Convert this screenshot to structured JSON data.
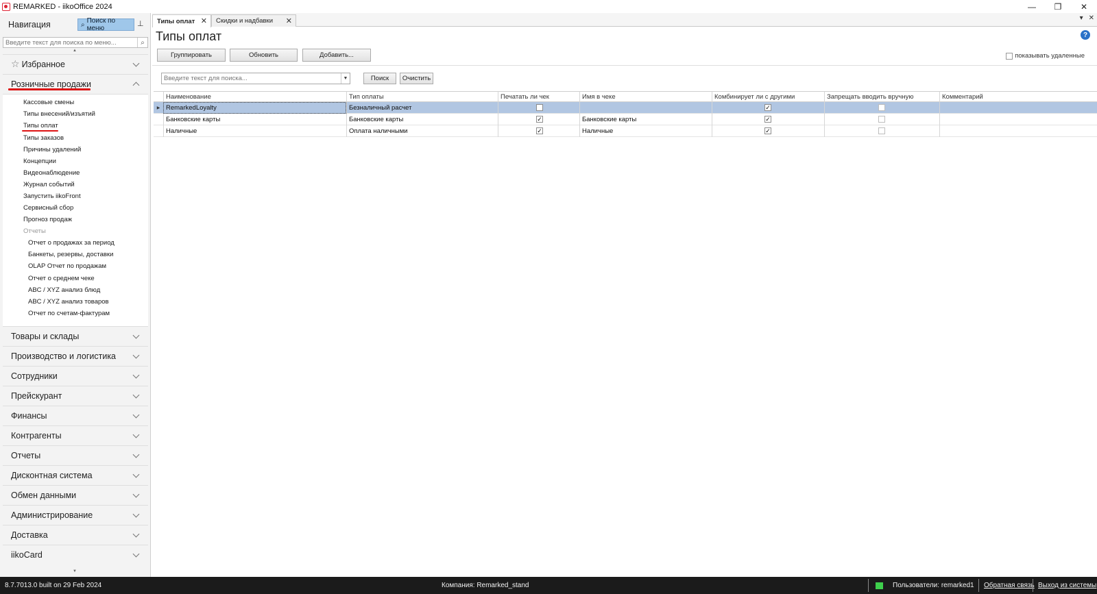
{
  "window": {
    "title": "REMARKED - iikoOffice 2024",
    "minimize": "—",
    "restore": "❐",
    "close": "✕"
  },
  "nav": {
    "title": "Навигация",
    "search_menu_btn": "Поиск по меню",
    "pin": "⊥",
    "search_placeholder": "Введите текст для поиска по меню...",
    "favorites": "Избранное",
    "retail": "Розничные продажи",
    "retail_items": [
      "Кассовые смены",
      "Типы внесений/изъятий",
      "Типы оплат",
      "Типы заказов",
      "Причины удалений",
      "Концепции",
      "Видеонаблюдение",
      "Журнал событий",
      "Запустить iikoFront",
      "Сервисный сбор",
      "Прогноз продаж"
    ],
    "reports_group": "Отчеты",
    "report_items": [
      "Отчет о продажах за период",
      "Банкеты, резервы, доставки",
      "OLAP Отчет по продажам",
      "Отчет о среднем чеке",
      "ABC / XYZ анализ блюд",
      "ABC / XYZ анализ товаров",
      "Отчет по счетам-фактурам"
    ],
    "sections": [
      "Товары и склады",
      "Производство и логистика",
      "Сотрудники",
      "Прейскурант",
      "Финансы",
      "Контрагенты",
      "Отчеты",
      "Дисконтная система",
      "Обмен данными",
      "Администрирование",
      "Доставка",
      "iikoCard"
    ]
  },
  "tabs": [
    {
      "label": "Типы оплат",
      "active": true
    },
    {
      "label": "Скидки и надбавки",
      "active": false
    }
  ],
  "page": {
    "title": "Типы оплат",
    "btn_group": "Группировать",
    "btn_refresh": "Обновить",
    "btn_add": "Добавить...",
    "show_deleted": "показывать удаленные",
    "search_placeholder": "Введите текст для поиска...",
    "btn_search": "Поиск",
    "btn_clear": "Очистить"
  },
  "grid": {
    "columns": [
      "Наименование",
      "Тип оплаты",
      "Печатать ли чек",
      "Имя в чеке",
      "Комбинирует ли с другими",
      "Запрещать вводить вручную",
      "Комментарий"
    ],
    "rows": [
      {
        "name": "RemarkedLoyalty",
        "type": "Безналичный расчет",
        "print": false,
        "receipt_name": "",
        "combine": true,
        "forbid_manual": false,
        "comment": "",
        "selected": true
      },
      {
        "name": "Банковские карты",
        "type": "Банковские карты",
        "print": true,
        "receipt_name": "Банковские карты",
        "combine": true,
        "forbid_manual": false,
        "comment": "",
        "selected": false
      },
      {
        "name": "Наличные",
        "type": "Оплата наличными",
        "print": true,
        "receipt_name": "Наличные",
        "combine": true,
        "forbid_manual": false,
        "comment": "",
        "selected": false
      }
    ]
  },
  "status": {
    "version": "8.7.7013.0 built on 29 Feb 2024",
    "company": "Компания: Remarked_stand",
    "users": "Пользователи: remarked1",
    "feedback": "Обратная связь",
    "logout": "Выход из системы"
  }
}
